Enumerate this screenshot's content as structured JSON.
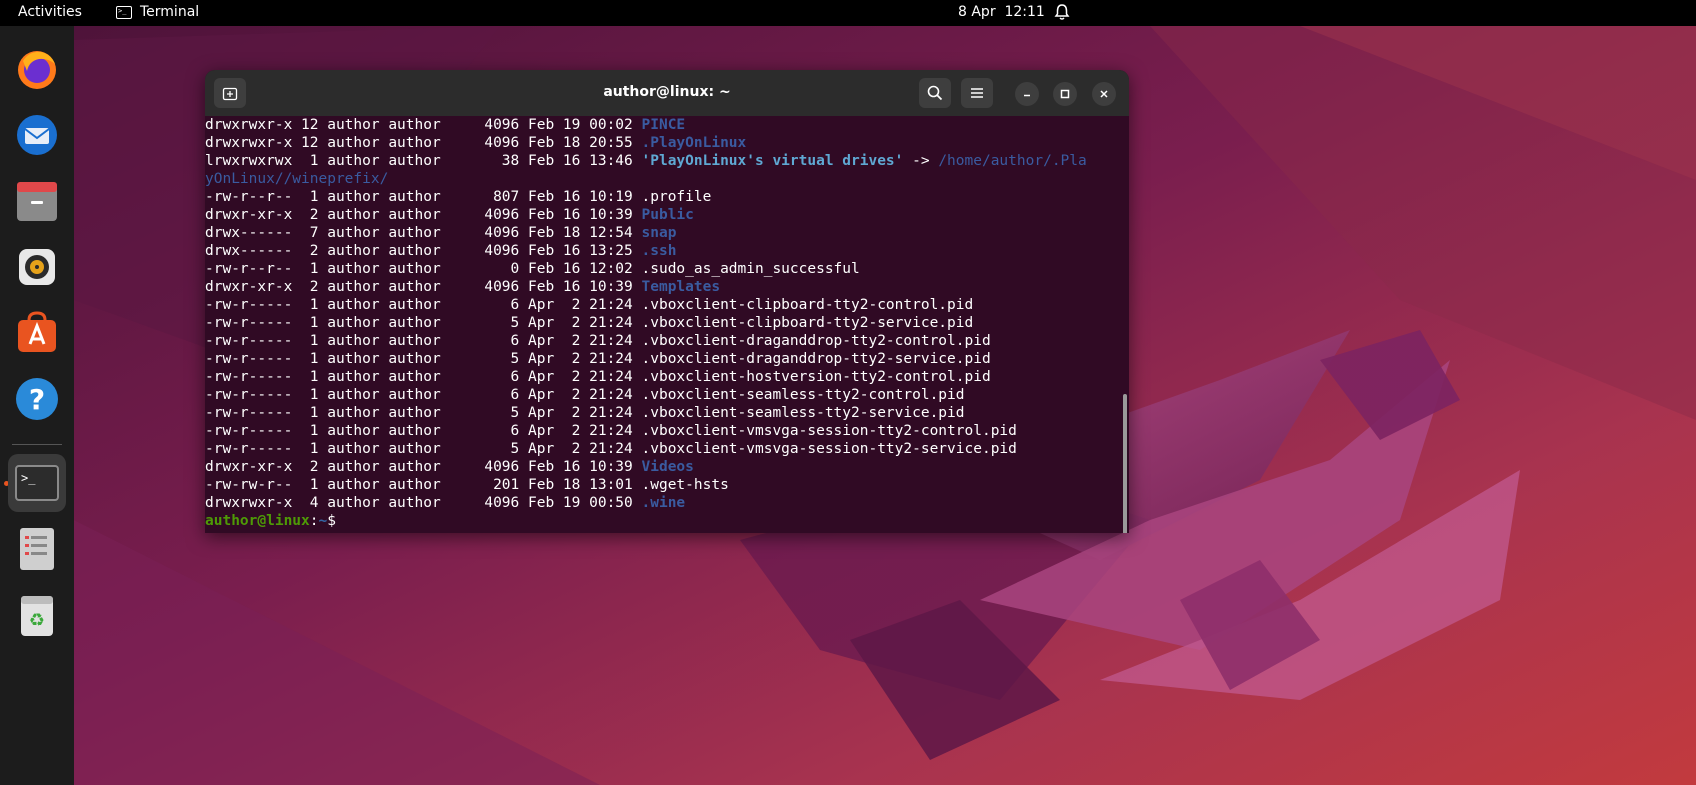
{
  "topbar": {
    "activities": "Activities",
    "app_name": "Terminal",
    "date": "8 Apr",
    "time": "12:11"
  },
  "dock": {
    "items": [
      {
        "name": "firefox-icon"
      },
      {
        "name": "thunderbird-icon"
      },
      {
        "name": "files-icon"
      },
      {
        "name": "rhythmbox-icon"
      },
      {
        "name": "software-icon"
      },
      {
        "name": "help-icon"
      },
      {
        "name": "terminal-icon"
      },
      {
        "name": "text-editor-icon"
      },
      {
        "name": "trash-icon"
      }
    ]
  },
  "window": {
    "title": "author@linux: ~"
  },
  "terminal": {
    "lines": [
      {
        "meta": "drwxrwxr-x 12 author author     4096 Feb 19 00:02 ",
        "name": "PINCE",
        "kind": "dir"
      },
      {
        "meta": "drwxrwxr-x 12 author author     4096 Feb 18 20:55 ",
        "name": ".PlayOnLinux",
        "kind": "dir"
      },
      {
        "meta": "lrwxrwxrwx  1 author author       38 Feb 16 13:46 ",
        "name": "'PlayOnLinux's virtual drives'",
        "kind": "link",
        "arrow": " -> ",
        "target": "/home/author/.Pla"
      },
      {
        "meta": "",
        "name": "yOnLinux//wineprefix/",
        "kind": "linkcont"
      },
      {
        "meta": "-rw-r--r--  1 author author      807 Feb 16 10:19 ",
        "name": ".profile",
        "kind": "file"
      },
      {
        "meta": "drwxr-xr-x  2 author author     4096 Feb 16 10:39 ",
        "name": "Public",
        "kind": "dir"
      },
      {
        "meta": "drwx------  7 author author     4096 Feb 18 12:54 ",
        "name": "snap",
        "kind": "dir"
      },
      {
        "meta": "drwx------  2 author author     4096 Feb 16 13:25 ",
        "name": ".ssh",
        "kind": "dir"
      },
      {
        "meta": "-rw-r--r--  1 author author        0 Feb 16 12:02 ",
        "name": ".sudo_as_admin_successful",
        "kind": "file"
      },
      {
        "meta": "drwxr-xr-x  2 author author     4096 Feb 16 10:39 ",
        "name": "Templates",
        "kind": "dir"
      },
      {
        "meta": "-rw-r-----  1 author author        6 Apr  2 21:24 ",
        "name": ".vboxclient-clipboard-tty2-control.pid",
        "kind": "file"
      },
      {
        "meta": "-rw-r-----  1 author author        5 Apr  2 21:24 ",
        "name": ".vboxclient-clipboard-tty2-service.pid",
        "kind": "file"
      },
      {
        "meta": "-rw-r-----  1 author author        6 Apr  2 21:24 ",
        "name": ".vboxclient-draganddrop-tty2-control.pid",
        "kind": "file"
      },
      {
        "meta": "-rw-r-----  1 author author        5 Apr  2 21:24 ",
        "name": ".vboxclient-draganddrop-tty2-service.pid",
        "kind": "file"
      },
      {
        "meta": "-rw-r-----  1 author author        6 Apr  2 21:24 ",
        "name": ".vboxclient-hostversion-tty2-control.pid",
        "kind": "file"
      },
      {
        "meta": "-rw-r-----  1 author author        6 Apr  2 21:24 ",
        "name": ".vboxclient-seamless-tty2-control.pid",
        "kind": "file"
      },
      {
        "meta": "-rw-r-----  1 author author        5 Apr  2 21:24 ",
        "name": ".vboxclient-seamless-tty2-service.pid",
        "kind": "file"
      },
      {
        "meta": "-rw-r-----  1 author author        6 Apr  2 21:24 ",
        "name": ".vboxclient-vmsvga-session-tty2-control.pid",
        "kind": "file"
      },
      {
        "meta": "-rw-r-----  1 author author        5 Apr  2 21:24 ",
        "name": ".vboxclient-vmsvga-session-tty2-service.pid",
        "kind": "file"
      },
      {
        "meta": "drwxr-xr-x  2 author author     4096 Feb 16 10:39 ",
        "name": "Videos",
        "kind": "dir"
      },
      {
        "meta": "-rw-rw-r--  1 author author      201 Feb 18 13:01 ",
        "name": ".wget-hsts",
        "kind": "file"
      },
      {
        "meta": "drwxrwxr-x  4 author author     4096 Feb 19 00:50 ",
        "name": ".wine",
        "kind": "dir"
      }
    ],
    "prompt_user": "author@linux",
    "prompt_sep": ":",
    "prompt_path": "~",
    "prompt_symbol": "$ "
  }
}
